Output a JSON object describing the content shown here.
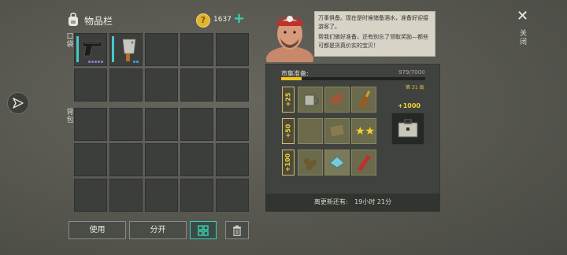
{
  "inventory": {
    "title": "物品栏",
    "gold": "1637",
    "pocket_label": "口袋",
    "bag_label": "背包"
  },
  "buttons": {
    "use": "使用",
    "split": "分开"
  },
  "npc": {
    "line1": "万事俱备。现在是时候储备酒水，准备好迎接游客了。",
    "line2": "帮我们做好准备，还有别忘了领取奖励—都些可都是货真价实的宝贝！"
  },
  "market": {
    "label": "市集准备:",
    "progress_text": "979/7000",
    "progress": 0.14,
    "level": "第 31 级",
    "tiers": [
      "+25",
      "+50",
      "+100"
    ],
    "reward": "+1000",
    "timer_label": "离更新还有:",
    "timer_value": "19小时 21分"
  },
  "close": {
    "label": "关闭"
  },
  "colors": {
    "accent_gold": "#f2c418",
    "accent_teal": "#3bd4b2",
    "rarity_purple": "#8f7fd8",
    "rarity_blue": "#4aa6e8"
  }
}
